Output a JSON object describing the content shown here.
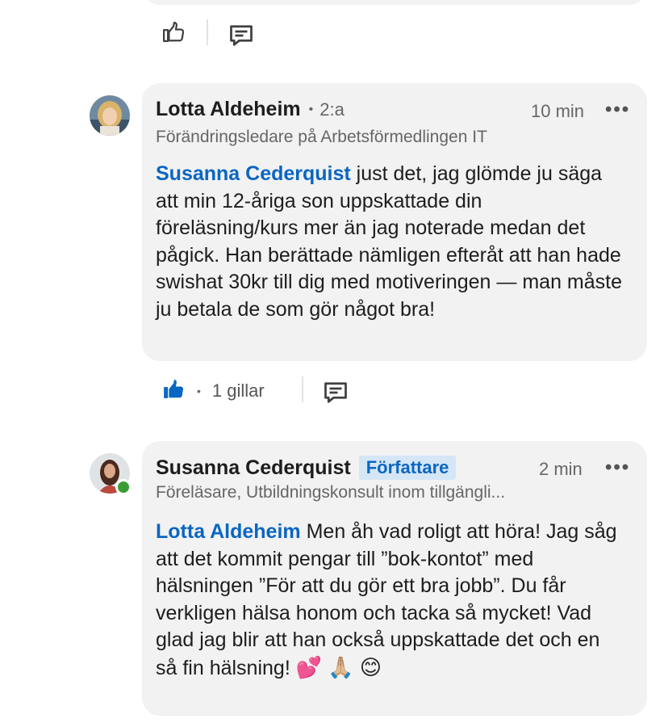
{
  "comments": [
    {
      "author": "Lotta Aldeheim",
      "degree": "2:a",
      "time": "10 min",
      "more": "•••",
      "headline": "Förändringsledare på Arbetsförmedlingen IT",
      "mention": "Susanna Cederquist",
      "text": " just det, jag glömde ju säga att min 12-åriga son uppskattade din föreläsning/kurs mer än jag noterade medan det pågick. Han berättade nämligen efteråt att han hade swishat 30kr till dig med motiveringen — man måste ju betala de som gör något bra!",
      "likes": "1 gillar",
      "liked": true,
      "avatar": "avatar-lotta"
    },
    {
      "author": "Susanna Cederquist",
      "badge": "Författare",
      "time": "2 min",
      "more": "•••",
      "headline": "Föreläsare, Utbildningskonsult inom tillgängli...",
      "mention": "Lotta Aldeheim",
      "text": " Men åh vad roligt att höra! Jag såg att det kommit pengar till ”bok-kontot” med hälsningen ”För att du gör ett bra jobb”. Du får verkligen hälsa honom och tacka så mycket! Vad glad jag blir att han också uppskattade det och en så fin hälsning!",
      "emojis": "💕 🙏🏼 😊",
      "avatar": "avatar-susanna",
      "online": true
    }
  ],
  "colors": {
    "accent": "#0a66c2",
    "bubble": "#f2f2f3",
    "muted": "#666666",
    "online": "#3a9c34"
  },
  "icons": {
    "like": "thumbs-up-icon",
    "comment": "comment-icon",
    "more": "more-icon"
  }
}
